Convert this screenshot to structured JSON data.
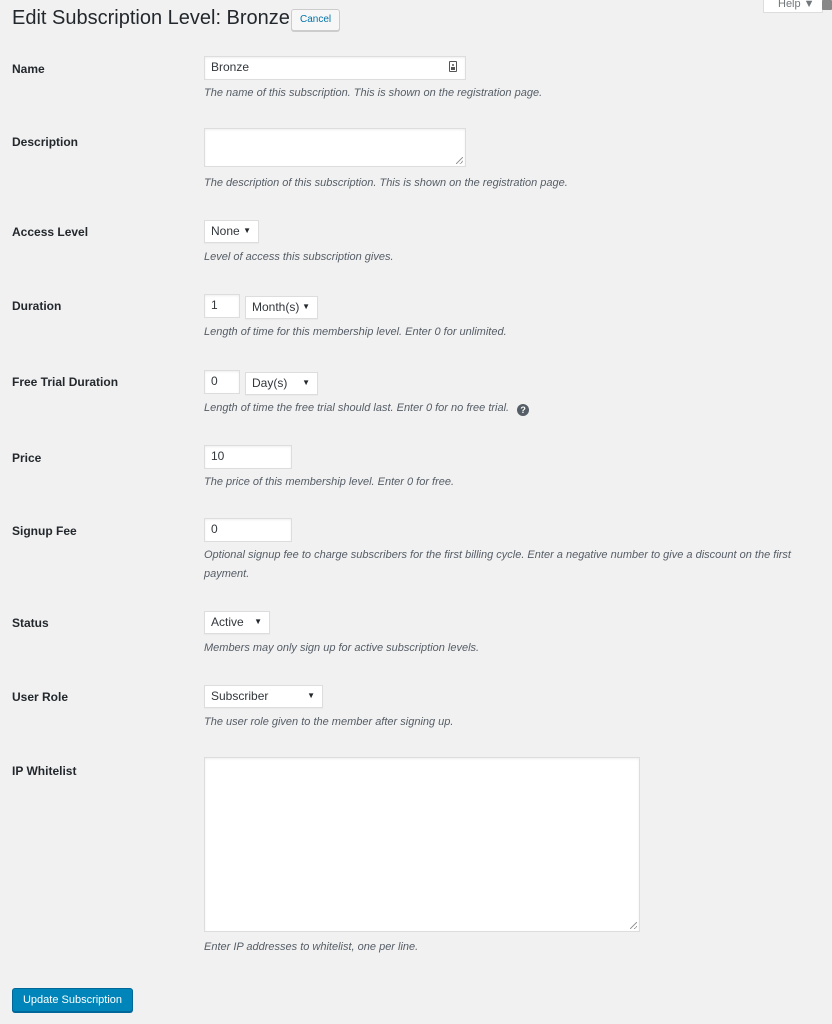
{
  "header": {
    "title": "Edit Subscription Level: Bronze",
    "cancel_label": "Cancel",
    "help_label": "Help ▼"
  },
  "fields": {
    "name": {
      "label": "Name",
      "value": "Bronze",
      "description": "The name of this subscription. This is shown on the registration page."
    },
    "description": {
      "label": "Description",
      "value": "",
      "description": "The description of this subscription. This is shown on the registration page."
    },
    "access_level": {
      "label": "Access Level",
      "selected": "None",
      "description": "Level of access this subscription gives."
    },
    "duration": {
      "label": "Duration",
      "value": "1",
      "unit": "Month(s)",
      "description": "Length of time for this membership level. Enter 0 for unlimited."
    },
    "free_trial": {
      "label": "Free Trial Duration",
      "value": "0",
      "unit": "Day(s)",
      "description": "Length of time the free trial should last. Enter 0 for no free trial.",
      "help_glyph": "?"
    },
    "price": {
      "label": "Price",
      "value": "10",
      "description": "The price of this membership level. Enter 0 for free."
    },
    "signup_fee": {
      "label": "Signup Fee",
      "value": "0",
      "description": "Optional signup fee to charge subscribers for the first billing cycle. Enter a negative number to give a discount on the first payment."
    },
    "status": {
      "label": "Status",
      "selected": "Active",
      "description": "Members may only sign up for active subscription levels."
    },
    "user_role": {
      "label": "User Role",
      "selected": "Subscriber",
      "description": "The user role given to the member after signing up."
    },
    "ip_whitelist": {
      "label": "IP Whitelist",
      "value": "",
      "description": "Enter IP addresses to whitelist, one per line."
    }
  },
  "footer": {
    "submit_label": "Update Subscription"
  },
  "icons": {
    "caret": "▼",
    "help": "question-circle-icon",
    "contact-card": "contact-card-icon"
  },
  "colors": {
    "background": "#f1f1f1",
    "primary_button": "#0085ba",
    "link": "#0073aa"
  }
}
